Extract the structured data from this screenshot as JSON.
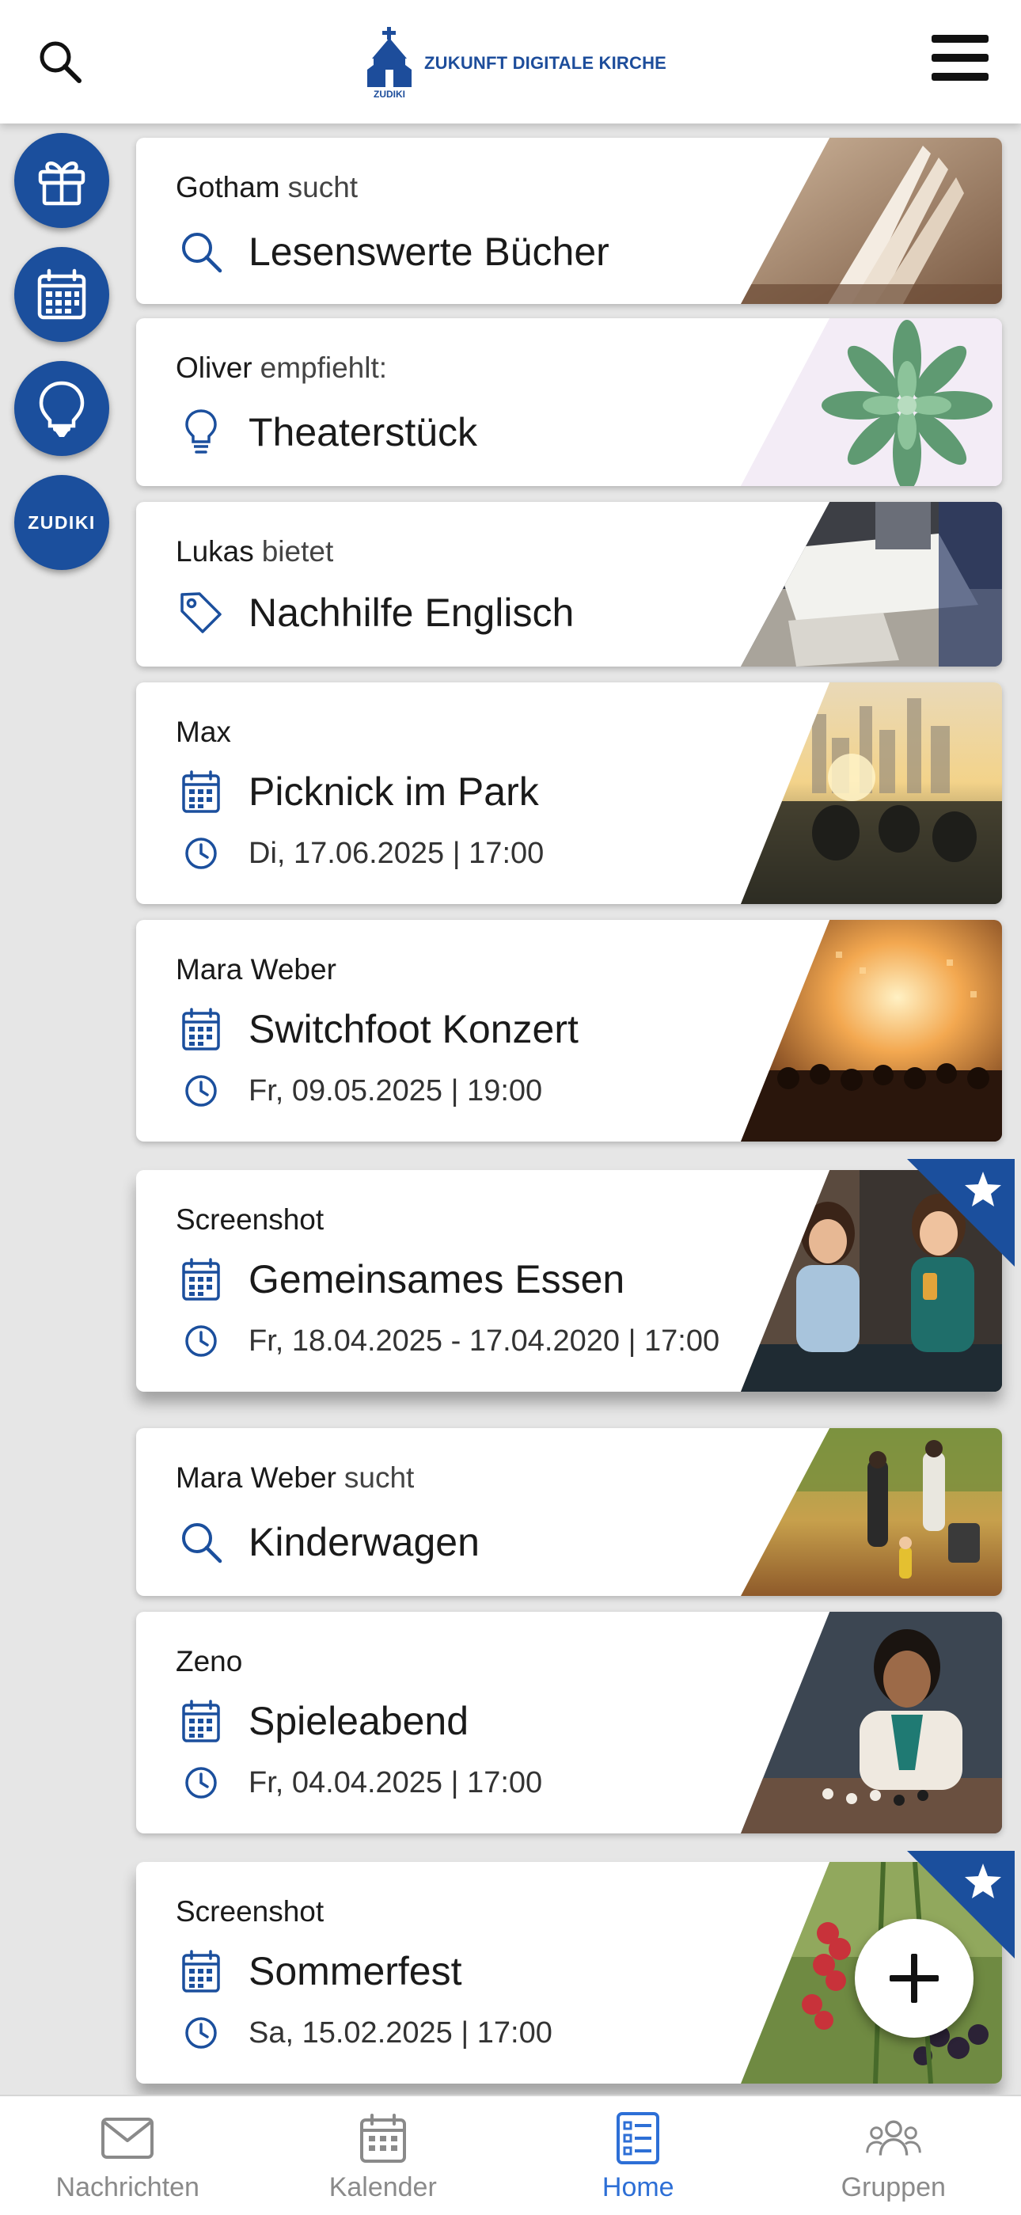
{
  "header": {
    "logo_text": "ZUKUNFT DIGITALE KIRCHE",
    "logo_subtext": "ZUDIKI"
  },
  "side": {
    "zudiki_label": "ZUDIKI"
  },
  "colors": {
    "brand": "#1b4f9d",
    "accent": "#2d6fd6",
    "star_flag": "#1b4f9d"
  },
  "cards": [
    {
      "author": "Gotham",
      "verb": "sucht",
      "icon": "search-icon",
      "title": "Lesenswerte Bücher"
    },
    {
      "author": "Oliver",
      "verb": "empfiehlt:",
      "icon": "lightbulb-icon",
      "title": "Theaterstück"
    },
    {
      "author": "Lukas",
      "verb": "bietet",
      "icon": "tag-icon",
      "title": "Nachhilfe Englisch"
    },
    {
      "author": "Max",
      "icon": "calendar-icon",
      "title": "Picknick im Park",
      "date": "Di, 17.06.2025 | 17:00"
    },
    {
      "author": "Mara Weber",
      "icon": "calendar-icon",
      "title": "Switchfoot Konzert",
      "date": "Fr, 09.05.2025 | 19:00"
    },
    {
      "author": "Screenshot",
      "icon": "calendar-icon",
      "title": "Gemeinsames Essen",
      "date": "Fr, 18.04.2025 - 17.04.2020 | 17:00",
      "starred": true
    },
    {
      "author": "Mara Weber",
      "verb": "sucht",
      "icon": "search-icon",
      "title": "Kinderwagen"
    },
    {
      "author": "Zeno",
      "icon": "calendar-icon",
      "title": "Spieleabend",
      "date": "Fr, 04.04.2025 | 17:00"
    },
    {
      "author": "Screenshot",
      "icon": "calendar-icon",
      "title": "Sommerfest",
      "date": "Sa, 15.02.2025 | 17:00",
      "starred": true
    }
  ],
  "nav": [
    {
      "label": "Nachrichten",
      "icon": "envelope-icon"
    },
    {
      "label": "Kalender",
      "icon": "calendar-icon"
    },
    {
      "label": "Home",
      "icon": "list-icon",
      "active": true
    },
    {
      "label": "Gruppen",
      "icon": "group-icon"
    }
  ]
}
